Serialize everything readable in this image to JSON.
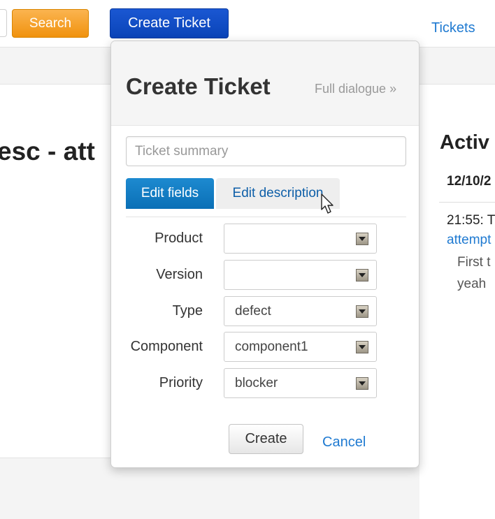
{
  "topbar": {
    "search_label": "Search",
    "create_ticket_label": "Create Ticket",
    "tickets_link": "Tickets"
  },
  "page": {
    "heading": "esc - att"
  },
  "activity": {
    "heading": "Activ",
    "date": "12/10/2",
    "time": "21:55: T",
    "link": "attempt",
    "line1": "First t",
    "line2": "yeah"
  },
  "popover": {
    "title": "Create Ticket",
    "full_dialogue": "Full dialogue »",
    "summary_placeholder": "Ticket summary",
    "summary_value": "",
    "tabs": [
      {
        "label": "Edit fields",
        "active": true
      },
      {
        "label": "Edit description",
        "active": false
      }
    ],
    "fields": [
      {
        "label": "Product",
        "value": ""
      },
      {
        "label": "Version",
        "value": ""
      },
      {
        "label": "Type",
        "value": "defect"
      },
      {
        "label": "Component",
        "value": "component1"
      },
      {
        "label": "Priority",
        "value": "blocker"
      }
    ],
    "create_label": "Create",
    "cancel_label": "Cancel"
  },
  "colors": {
    "search_button": "#f0920e",
    "create_ticket_button": "#0a44b8",
    "active_tab": "#0a6fb6",
    "link": "#1f7ad1"
  },
  "icons": {
    "cursor": "mouse-pointer-icon",
    "select_arrow": "select-arrow-icon"
  }
}
